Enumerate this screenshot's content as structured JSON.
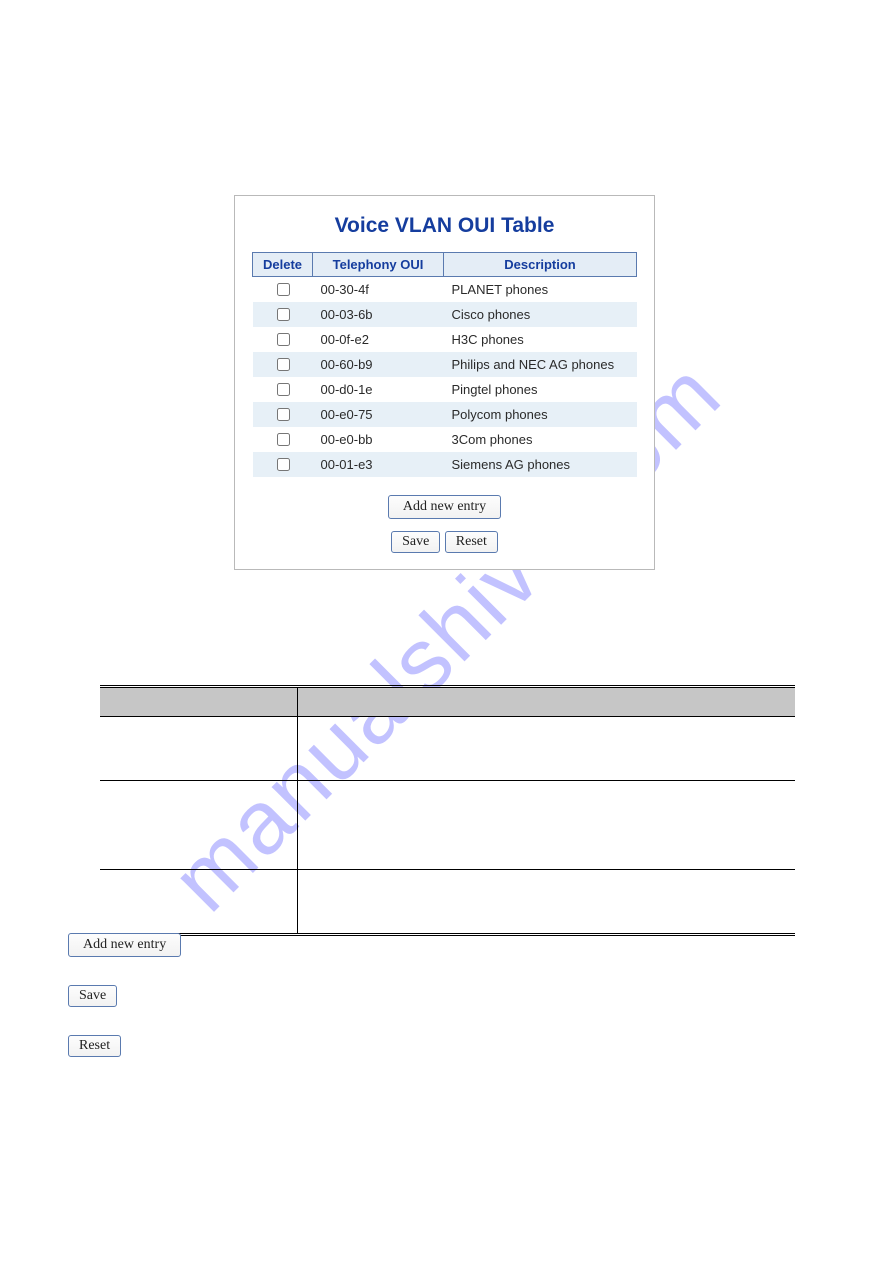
{
  "panel": {
    "title": "Voice VLAN OUI Table",
    "columns": {
      "delete": "Delete",
      "oui": "Telephony OUI",
      "desc": "Description"
    },
    "rows": [
      {
        "oui": "00-30-4f",
        "desc": "PLANET phones"
      },
      {
        "oui": "00-03-6b",
        "desc": "Cisco phones"
      },
      {
        "oui": "00-0f-e2",
        "desc": "H3C phones"
      },
      {
        "oui": "00-60-b9",
        "desc": "Philips and NEC AG phones"
      },
      {
        "oui": "00-d0-1e",
        "desc": "Pingtel phones"
      },
      {
        "oui": "00-e0-75",
        "desc": "Polycom phones"
      },
      {
        "oui": "00-e0-bb",
        "desc": "3Com phones"
      },
      {
        "oui": "00-01-e3",
        "desc": "Siemens AG phones"
      }
    ],
    "buttons": {
      "add": "Add new entry",
      "save": "Save",
      "reset": "Reset"
    }
  },
  "watermark": "manualshive.com",
  "demo_buttons": {
    "add": "Add new entry",
    "save": "Save",
    "reset": "Reset"
  }
}
